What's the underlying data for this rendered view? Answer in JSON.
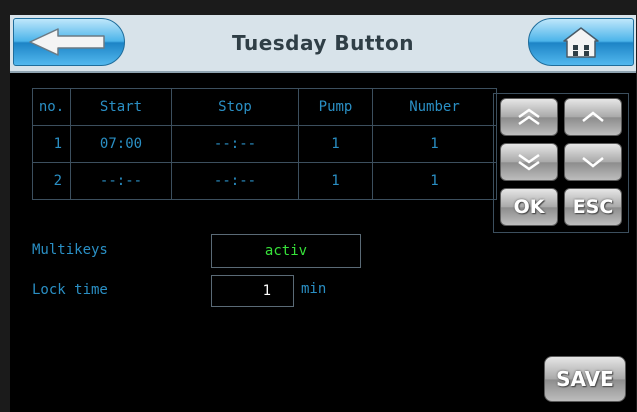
{
  "header": {
    "title": "Tuesday Button",
    "back_icon": "arrow-left-icon",
    "home_icon": "home-icon"
  },
  "table": {
    "columns": [
      "no.",
      "Start",
      "Stop",
      "Pump",
      "Number"
    ],
    "rows": [
      {
        "no": "1",
        "start": "07:00",
        "stop": "--:--",
        "pump": "1",
        "number": "1"
      },
      {
        "no": "2",
        "start": "--:--",
        "stop": "--:--",
        "pump": "1",
        "number": "1"
      }
    ]
  },
  "nav": {
    "page_up_icon": "double-chevron-up-icon",
    "up_icon": "chevron-up-icon",
    "page_down_icon": "double-chevron-down-icon",
    "down_icon": "chevron-down-icon",
    "ok_label": "OK",
    "esc_label": "ESC"
  },
  "settings": {
    "multikeys_label": "Multikeys",
    "multikeys_value": "activ",
    "locktime_label": "Lock time",
    "locktime_value": "1",
    "locktime_unit": "min"
  },
  "save_label": "SAVE",
  "colors": {
    "accent_blue": "#2a8fc4",
    "active_green": "#37e23a",
    "header_bg": "#d8e3ea"
  }
}
